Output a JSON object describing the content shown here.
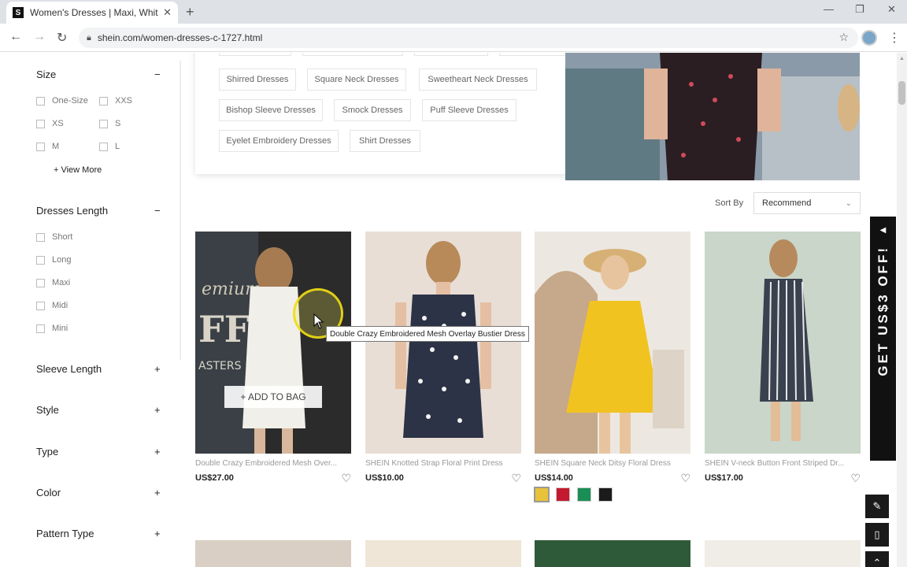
{
  "browser": {
    "tab_title": "Women's Dresses | Maxi, White, C",
    "tab_favicon": "S",
    "url": "shein.com/women-dresses-c-1727.html"
  },
  "sidebar": {
    "size": {
      "title": "Size",
      "toggle": "−",
      "options": [
        "One-Size",
        "XXS",
        "XS",
        "S",
        "M",
        "L"
      ],
      "view_more": "+ View More"
    },
    "dresses_length": {
      "title": "Dresses Length",
      "toggle": "−",
      "options": [
        "Short",
        "Long",
        "Maxi",
        "Midi",
        "Mini"
      ]
    },
    "collapsed_facets": [
      {
        "title": "Sleeve Length",
        "toggle": "+"
      },
      {
        "title": "Style",
        "toggle": "+"
      },
      {
        "title": "Type",
        "toggle": "+"
      },
      {
        "title": "Color",
        "toggle": "+"
      },
      {
        "title": "Pattern Type",
        "toggle": "+"
      }
    ]
  },
  "tags": [
    "Shirred Dresses",
    "Square Neck Dresses",
    "Sweetheart Neck Dresses",
    "Bishop Sleeve Dresses",
    "Smock Dresses",
    "Puff Sleeve Dresses",
    "Eyelet Embroidery Dresses",
    "Shirt Dresses"
  ],
  "sort": {
    "label": "Sort By",
    "value": "Recommend"
  },
  "products": [
    {
      "name": "Double Crazy Embroidered Mesh Over...",
      "price": "US$27.00",
      "bg": "#2b2b2b",
      "dress": "#f1efe9"
    },
    {
      "name": "SHEIN Knotted Strap Floral Print Dress",
      "price": "US$10.00",
      "bg": "#e9ded6",
      "dress": "#2c3346"
    },
    {
      "name": "SHEIN Square Neck Ditsy Floral Dress",
      "price": "US$14.00",
      "bg": "#ece8e1",
      "dress": "#f1c320"
    },
    {
      "name": "SHEIN V-neck Button Front Striped Dr...",
      "price": "US$17.00",
      "bg": "#c9d6c9",
      "dress": "#3a4250"
    }
  ],
  "swatches": [
    "#e8c23a",
    "#c4192f",
    "#1a8f55",
    "#1b1b1b"
  ],
  "hover": {
    "add_to_bag": "+ ADD TO BAG",
    "tooltip": "Double Crazy Embroidered Mesh Overlay Bustier Dress"
  },
  "promo": {
    "text": "GET US$3 OFF!",
    "arrow": "◀"
  },
  "colors": {
    "accent": "#111111",
    "cursor_highlight": "#f0dc14"
  }
}
